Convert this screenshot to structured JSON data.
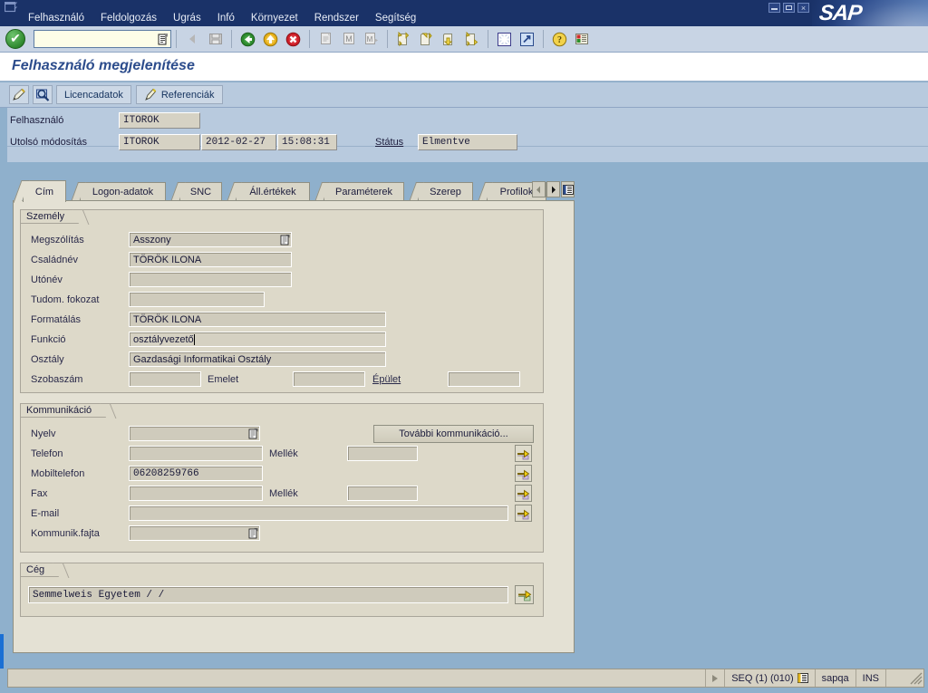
{
  "window": {
    "title": "",
    "brand": "SAP",
    "buttons": [
      "minimize",
      "restore",
      "close"
    ]
  },
  "menubar": {
    "items": [
      {
        "label": "Felhasználó",
        "accel": "z"
      },
      {
        "label": "Feldolgozás",
        "accel": "F"
      },
      {
        "label": "Ugrás",
        "accel": "U"
      },
      {
        "label": "Infó",
        "accel": "I"
      },
      {
        "label": "Környezet",
        "accel": "K"
      },
      {
        "label": "Rendszer",
        "accel": "R"
      },
      {
        "label": "Segítség",
        "accel": "S"
      }
    ]
  },
  "toolbar": {
    "enter_icon": "green-check-icon",
    "command_field": {
      "value": "",
      "placeholder": ""
    },
    "buttons": [
      {
        "name": "back-icon",
        "label": "Vissza"
      },
      {
        "name": "save-icon",
        "label": "Mentés"
      },
      {
        "name": "exit-green-arrow-icon",
        "label": "Kilépés"
      },
      {
        "name": "cancel-yellow-arrow-icon",
        "label": "Megszakítás"
      },
      {
        "name": "stop-red-x-icon",
        "label": "Befejezés"
      },
      {
        "name": "print-icon",
        "label": "Nyomtatás"
      },
      {
        "name": "find-icon",
        "label": "Keresés"
      },
      {
        "name": "find-next-icon",
        "label": "Tovább keres"
      },
      {
        "name": "first-page-icon",
        "label": "Első oldal"
      },
      {
        "name": "previous-page-icon",
        "label": "Előző oldal"
      },
      {
        "name": "next-page-icon",
        "label": "Következő oldal"
      },
      {
        "name": "last-page-icon",
        "label": "Utolsó oldal"
      },
      {
        "name": "create-session-icon",
        "label": "Új mód létrehozása"
      },
      {
        "name": "shortcut-icon",
        "label": "Parancsikon"
      },
      {
        "name": "help-icon",
        "label": "Súgó"
      },
      {
        "name": "customize-layout-icon",
        "label": "Elrendezés testreszabása"
      }
    ]
  },
  "page": {
    "title": "Felhasználó megjelenítése"
  },
  "apptoolbar": {
    "icon_buttons": [
      {
        "name": "change-pencil-icon",
        "label": "Módosítás"
      },
      {
        "name": "display-magnifier-icon",
        "label": "Megjelenítés"
      }
    ],
    "buttons": [
      {
        "name": "license-data-button",
        "label": "Licencadatok",
        "icon": ""
      },
      {
        "name": "references-button",
        "label": "Referenciák",
        "icon": "reference-icon"
      }
    ]
  },
  "header": {
    "user_label": "Felhasználó",
    "user_value": "ITOROK",
    "lastchange_label": "Utolsó módosítás",
    "lastchange_user": "ITOROK",
    "lastchange_date": "2012-02-27",
    "lastchange_time": "15:08:31",
    "status_label": "Státus",
    "status_value": "Elmentve"
  },
  "tabs": {
    "items": [
      {
        "label": "Cím",
        "active": true
      },
      {
        "label": "Logon-adatok",
        "active": false
      },
      {
        "label": "SNC",
        "active": false
      },
      {
        "label": "Áll.értékek",
        "active": false
      },
      {
        "label": "Paraméterek",
        "active": false
      },
      {
        "label": "Szerep",
        "active": false
      },
      {
        "label": "Profilok",
        "active": false
      }
    ],
    "nav": [
      {
        "name": "tab-scroll-left-button",
        "glyph": "left-triangle-icon"
      },
      {
        "name": "tab-scroll-right-button",
        "glyph": "right-triangle-icon"
      },
      {
        "name": "tab-list-button",
        "glyph": "tab-list-icon"
      }
    ]
  },
  "person": {
    "group_title": "Személy",
    "fields": [
      {
        "label": "Megszólítás",
        "value": "Asszony",
        "has_match": true,
        "mono": false,
        "focused": false
      },
      {
        "label": "Családnév",
        "value": "TÖRÖK ILONA",
        "has_match": false,
        "mono": false,
        "focused": false
      },
      {
        "label": "Utónév",
        "value": "",
        "has_match": false,
        "mono": false,
        "focused": false
      },
      {
        "label": "Tudom. fokozat",
        "value": "",
        "has_match": false,
        "mono": false,
        "focused": false
      },
      {
        "label": "Formatálás",
        "value": "TÖRÖK ILONA",
        "has_match": false,
        "mono": false,
        "focused": false
      },
      {
        "label": "Funkció",
        "value": "osztályvezető",
        "has_match": false,
        "mono": false,
        "focused": true
      },
      {
        "label": "Osztály",
        "value": "Gazdasági Informatikai Osztály",
        "has_match": false,
        "mono": false,
        "focused": false
      }
    ],
    "room_label": "Szobaszám",
    "room_value": "",
    "floor_label": "Emelet",
    "floor_value": "",
    "building_label": "Épület",
    "building_value": ""
  },
  "communication": {
    "group_title": "Kommunikáció",
    "more_button": "További kommunikáció...",
    "language_label": "Nyelv",
    "language_value": "",
    "phone_label": "Telefon",
    "phone_value": "",
    "phone_ext_label": "Mellék",
    "phone_ext_value": "",
    "mobile_label": "Mobiltelefon",
    "mobile_value": "06208259766",
    "fax_label": "Fax",
    "fax_value": "",
    "fax_ext_label": "Mellék",
    "fax_ext_value": "",
    "email_label": "E-mail",
    "email_value": "",
    "commtype_label": "Kommunik.fajta",
    "commtype_value": ""
  },
  "company": {
    "group_title": "Cég",
    "value": "Semmelweis Egyetem /  /"
  },
  "statusbar": {
    "message": "",
    "session": "SEQ (1) (010)",
    "server": "sapqa",
    "insert_mode": "INS"
  },
  "colors": {
    "title_blue": "#1a3268",
    "toolbar_blue": "#c8d4e4",
    "app_blue": "#b8cade",
    "panel_beige": "#e4e1d4",
    "group_beige": "#ddd9c9",
    "field_gray": "#cfcbbc",
    "outer_blue": "#8fb0cc",
    "accent_blue": "#1a6fd4",
    "title_text": "#2c4c8c"
  }
}
